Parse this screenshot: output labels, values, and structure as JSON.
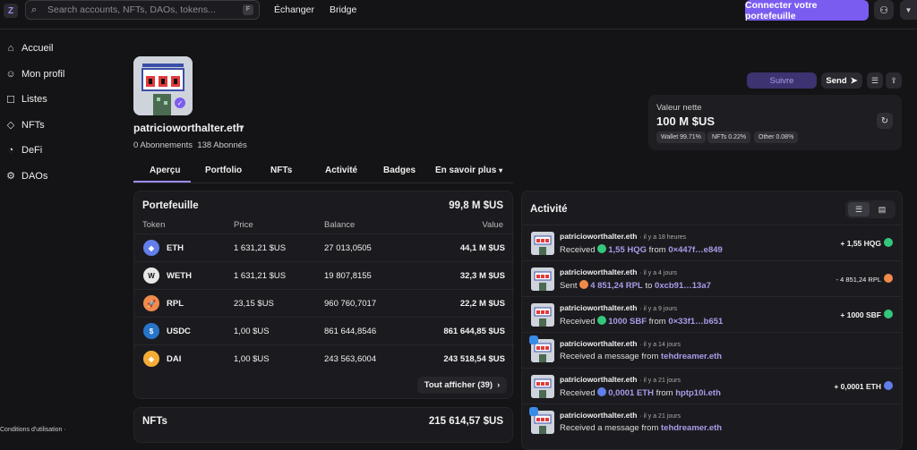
{
  "header": {
    "search_placeholder": "Search accounts, NFTs, DAOs, tokens...",
    "search_shortcut": "F",
    "nav": [
      "Échanger",
      "Bridge"
    ],
    "connect_label": "Connecter votre portefeuille"
  },
  "sidebar": {
    "items": [
      {
        "label": "Accueil",
        "icon": "home-icon"
      },
      {
        "label": "Mon profil",
        "icon": "user-icon"
      },
      {
        "label": "Listes",
        "icon": "list-icon"
      },
      {
        "label": "NFTs",
        "icon": "nft-icon"
      },
      {
        "label": "DeFi",
        "icon": "defi-icon"
      },
      {
        "label": "DAOs",
        "icon": "dao-icon"
      }
    ],
    "terms": "Conditions d'utilisation  ·"
  },
  "profile": {
    "name": "patricioworthalter.eth",
    "following": "0 Abonnements",
    "followers": "138 Abonnés",
    "follow_label": "Suivre",
    "send_label": "Send"
  },
  "tabs": [
    "Aperçu",
    "Portfolio",
    "NFTs",
    "Activité",
    "Badges",
    "En savoir plus"
  ],
  "net_worth": {
    "label": "Valeur nette",
    "value": "100 M $US",
    "pills": [
      "Wallet 99.71%",
      "NFTs 0.22%",
      "Other 0.08%"
    ]
  },
  "portfolio": {
    "title": "Portefeuille",
    "total": "99,8 M $US",
    "columns": [
      "Token",
      "Price",
      "Balance",
      "Value"
    ],
    "rows": [
      {
        "symbol": "ETH",
        "price": "1 631,21 $US",
        "balance": "27 013,0505",
        "value": "44,1 M $US",
        "color": "#627eea"
      },
      {
        "symbol": "WETH",
        "price": "1 631,21 $US",
        "balance": "19 807,8155",
        "value": "32,3 M $US",
        "color": "#e8e8e8"
      },
      {
        "symbol": "RPL",
        "price": "23,15 $US",
        "balance": "960 760,7017",
        "value": "22,2 M $US",
        "color": "#f08a4b"
      },
      {
        "symbol": "USDC",
        "price": "1,00 $US",
        "balance": "861 644,8546",
        "value": "861 644,85 $US",
        "color": "#2775ca"
      },
      {
        "symbol": "DAI",
        "price": "1,00 $US",
        "balance": "243 563,6004",
        "value": "243 518,54 $US",
        "color": "#f5ac37"
      }
    ],
    "show_all": "Tout afficher (39)"
  },
  "nfts": {
    "title": "NFTs",
    "total": "215 614,57 $US"
  },
  "activity": {
    "title": "Activité",
    "items": [
      {
        "who": "patricioworthalter.eth",
        "time": "· il y a 18 heures",
        "verb": "Received",
        "amount": "1,55 HQG",
        "prep": "from",
        "party": "0×447f…e849",
        "right": "+ 1,55 HQG",
        "coin": "#34c77b"
      },
      {
        "who": "patricioworthalter.eth",
        "time": "· il y a 4 jours",
        "verb": "Sent",
        "amount": "4 851,24 RPL",
        "prep": "to",
        "party": "0xcb91…13a7",
        "right": "- 4 851,24 RPL",
        "coin": "#f08a4b"
      },
      {
        "who": "patricioworthalter.eth",
        "time": "· il y a 9 jours",
        "verb": "Received",
        "amount": "1000 SBF",
        "prep": "from",
        "party": "0×33f1…b651",
        "right": "+ 1000 SBF",
        "coin": "#34c77b"
      },
      {
        "who": "patricioworthalter.eth",
        "time": "· il y a 14 jours",
        "verb": "Received a message from",
        "amount": "",
        "prep": "",
        "party": "tehdreamer.eth",
        "right": "",
        "coin": ""
      },
      {
        "who": "patricioworthalter.eth",
        "time": "· il y a 21 jours",
        "verb": "Received",
        "amount": "0,0001 ETH",
        "prep": "from",
        "party": "hptp10i.eth",
        "right": "+ 0,0001 ETH",
        "coin": "#627eea"
      },
      {
        "who": "patricioworthalter.eth",
        "time": "· il y a 21 jours",
        "verb": "Received a message from",
        "amount": "",
        "prep": "",
        "party": "tehdreamer.eth",
        "right": "",
        "coin": ""
      }
    ]
  }
}
